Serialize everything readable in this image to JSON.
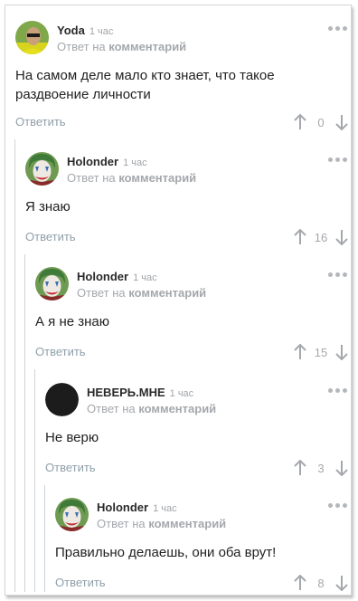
{
  "comments": [
    {
      "author": "Yoda",
      "time": "1 час",
      "reply_prefix": "Ответ на",
      "reply_link": "комментарий",
      "text_lines": [
        "На самом деле мало кто знает, что такое",
        "раздвоение личности"
      ],
      "reply_label": "Ответить",
      "votes": "0",
      "avatar": "photo-avatar"
    },
    {
      "author": "Holonder",
      "time": "1 час",
      "reply_prefix": "Ответ на",
      "reply_link": "комментарий",
      "text_lines": [
        "Я знаю"
      ],
      "reply_label": "Ответить",
      "votes": "16",
      "avatar": "joker-avatar"
    },
    {
      "author": "Holonder",
      "time": "1 час",
      "reply_prefix": "Ответ на",
      "reply_link": "комментарий",
      "text_lines": [
        "А я не знаю"
      ],
      "reply_label": "Ответить",
      "votes": "15",
      "avatar": "joker-avatar"
    },
    {
      "author": "НЕВЕРЬ.МНЕ",
      "time": "1 час",
      "reply_prefix": "Ответ на",
      "reply_link": "комментарий",
      "text_lines": [
        "Не верю"
      ],
      "reply_label": "Ответить",
      "votes": "3",
      "avatar": "black-circle-avatar"
    },
    {
      "author": "Holonder",
      "time": "1 час",
      "reply_prefix": "Ответ на",
      "reply_link": "комментарий",
      "text_lines": [
        "Правильно делаешь, они оба врут!"
      ],
      "reply_label": "Ответить",
      "votes": "8",
      "avatar": "joker-avatar"
    }
  ],
  "colors": {
    "thread_line": "#cfd3d6",
    "meta_text": "#a4a8ac",
    "reply_button": "#8fa0aa"
  }
}
